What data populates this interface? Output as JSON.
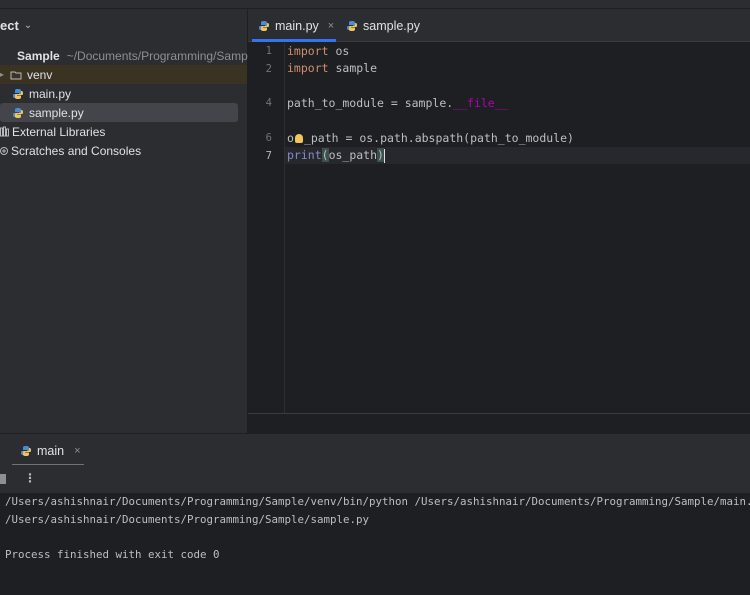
{
  "sidebar": {
    "title": "ect",
    "items": [
      {
        "label": "Sample",
        "path": "~/Documents/Programming/Sample",
        "icon": "folder-icon"
      },
      {
        "label": "venv",
        "icon": "folder-icon"
      },
      {
        "label": "main.py",
        "icon": "python-file-icon"
      },
      {
        "label": "sample.py",
        "icon": "python-file-icon"
      },
      {
        "label": "External Libraries",
        "icon": "libraries-icon"
      },
      {
        "label": "Scratches and Consoles",
        "icon": "scratches-icon"
      }
    ]
  },
  "editor": {
    "tabs": [
      {
        "label": "main.py",
        "active": true,
        "close": "×"
      },
      {
        "label": "sample.py",
        "active": false
      }
    ],
    "line_numbers": [
      "1",
      "2",
      "4",
      "6",
      "7"
    ],
    "current_line": "7",
    "code": {
      "l1_kw": "import",
      "l1_rest": " os",
      "l2_kw": "import",
      "l2_rest": " sample",
      "l4_pre": "path_to_module = sample.",
      "l4_dunder": "__file__",
      "l6_a": "o",
      "l6_b": "_path = os.path.abspath(path_to_module)",
      "l7_fn": "print",
      "l7_paren": "(",
      "l7_arg": "os_path",
      "l7_close": ")"
    }
  },
  "run": {
    "tab_label": "main",
    "tab_close": "×",
    "more_icon": "⋮",
    "console_lines": [
      "/Users/ashishnair/Documents/Programming/Sample/venv/bin/python /Users/ashishnair/Documents/Programming/Sample/main.py",
      "/Users/ashishnair/Documents/Programming/Sample/sample.py",
      "Process finished with exit code 0"
    ]
  },
  "colors": {
    "accent": "#3574f0",
    "keyword": "#cf8e6d",
    "dunder": "#b200b2",
    "builtin": "#8888c6"
  }
}
